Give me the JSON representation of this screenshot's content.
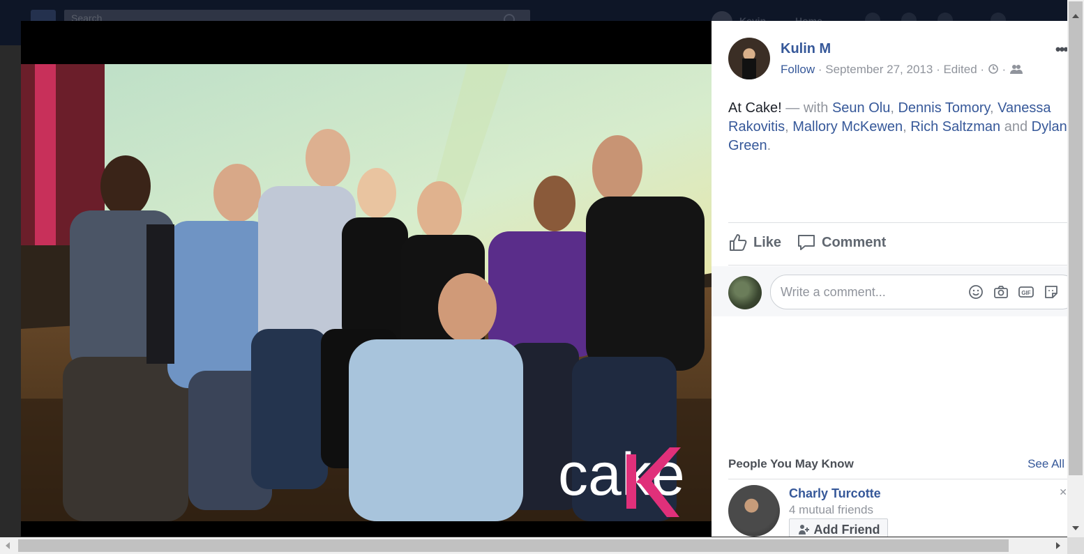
{
  "background": {
    "search_placeholder": "Search",
    "user_name": "Kevin",
    "home_label": "Home"
  },
  "photo": {
    "watermark": "cake"
  },
  "post": {
    "author": "Kulin M",
    "follow_label": "Follow",
    "date": "September 27, 2013",
    "edited_label": "Edited",
    "separator": "·",
    "more_label": "•••",
    "caption_text": "At Cake!",
    "with_label": "— with",
    "tagged": [
      "Seun Olu",
      "Dennis Tomory",
      "Vanessa Rakovitis",
      "Mallory McKewen",
      "Rich Saltzman",
      "Dylan Green"
    ],
    "and_label": "and",
    "comma": ",",
    "period": "."
  },
  "actions": {
    "like_label": "Like",
    "comment_label": "Comment"
  },
  "comment_box": {
    "placeholder": "Write a comment..."
  },
  "pymk": {
    "title": "People You May Know",
    "see_all": "See All",
    "person_name": "Charly Turcotte",
    "mutual": "4 mutual friends",
    "add_friend": "Add Friend"
  },
  "colors": {
    "link": "#365899",
    "secondary": "#90949c",
    "header_bg": "#0e1627"
  }
}
